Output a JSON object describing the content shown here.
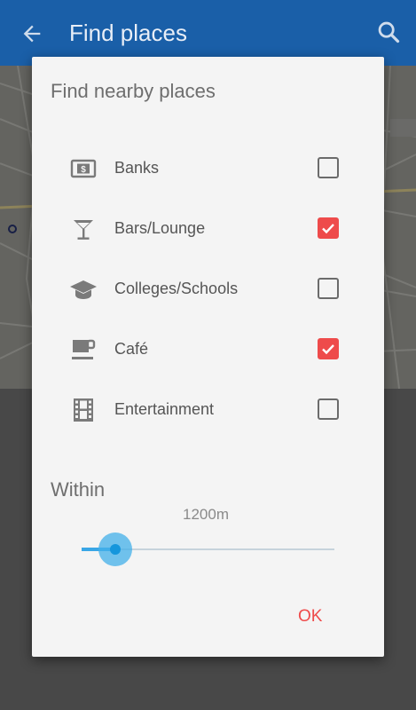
{
  "appbar": {
    "title": "Find places"
  },
  "dialog": {
    "title": "Find nearby places",
    "categories": [
      {
        "label": "Banks",
        "icon": "bank-icon",
        "checked": false
      },
      {
        "label": "Bars/Lounge",
        "icon": "cocktail-icon",
        "checked": true
      },
      {
        "label": "Colleges/Schools",
        "icon": "graduation-cap-icon",
        "checked": false
      },
      {
        "label": "Café",
        "icon": "coffee-cup-icon",
        "checked": true
      },
      {
        "label": "Entertainment",
        "icon": "film-icon",
        "checked": false
      }
    ],
    "within_label": "Within",
    "distance": "1200m",
    "ok_label": "OK"
  },
  "colors": {
    "appbar": "#1a5fa8",
    "accent": "#ee4b4b",
    "slider": "#39a6e6"
  }
}
